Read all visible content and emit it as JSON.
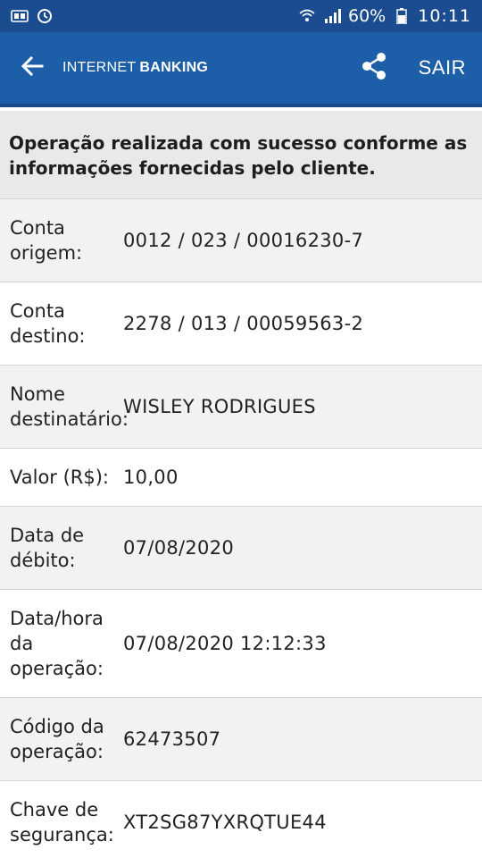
{
  "status_bar": {
    "battery": "60%",
    "time": "10:11",
    "icons": [
      "sim-card-icon",
      "alarm-icon",
      "wifi-icon",
      "signal-icon",
      "battery-icon"
    ]
  },
  "app_bar": {
    "brand_light": "INTERNET",
    "brand_bold": "BANKING",
    "exit_label": "SAIR",
    "icons": [
      "back-arrow-icon",
      "share-icon"
    ]
  },
  "message": "Operação realizada com sucesso conforme as informações fornecidas pelo cliente.",
  "rows": [
    {
      "label": "Conta origem:",
      "value": "0012 / 023 / 00016230-7"
    },
    {
      "label": "Conta destino:",
      "value": "2278 / 013 / 00059563-2"
    },
    {
      "label": "Nome destinatário:",
      "value": "WISLEY RODRIGUES"
    },
    {
      "label": "Valor (R$):",
      "value": "10,00"
    },
    {
      "label": "Data de débito:",
      "value": "07/08/2020"
    },
    {
      "label": "Data/hora da operação:",
      "value": "07/08/2020 12:12:33"
    },
    {
      "label": "Código da operação:",
      "value": "62473507"
    },
    {
      "label": "Chave de segurança:",
      "value": "XT2SG87YXRQTUE44"
    }
  ],
  "colors": {
    "status_bar": "#1a4c8f",
    "app_bar": "#1d5ea8",
    "shaded_row": "#f2f2f2",
    "message_bg": "#e9e9e9"
  }
}
